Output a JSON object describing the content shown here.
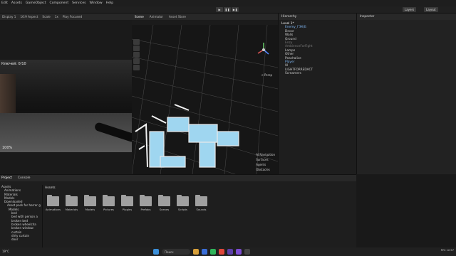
{
  "menu": [
    "Edit",
    "Assets",
    "GameObject",
    "Component",
    "Services",
    "Window",
    "Help"
  ],
  "toolbar": {
    "play": "▶",
    "pause": "❚❚",
    "step": "▶❚",
    "layers": "Layers",
    "layout": "Layout"
  },
  "game": {
    "tabs": [
      "Display 1",
      "16:9 Aspect",
      "Scale",
      "1x",
      "Play Focused"
    ],
    "hud_top": "Ключей: 0/10",
    "hud_bottom": "100%"
  },
  "scene": {
    "tabs": [
      "Scene",
      "Animator",
      "Asset Store"
    ],
    "gizmo": "< Persp",
    "overlay": [
      "AI Navigation",
      "Surfaces",
      "Agents",
      "Obstacles"
    ]
  },
  "hierarchy": {
    "title": "Hierarchy",
    "items": [
      {
        "label": "Level 1*",
        "indent": 0,
        "style": "normal"
      },
      {
        "label": "Enemy_ГЗК(Б",
        "indent": 1,
        "style": "blue"
      },
      {
        "label": "Decor",
        "indent": 1,
        "style": "normal"
      },
      {
        "label": "Walls",
        "indent": 1,
        "style": "normal"
      },
      {
        "label": "Ground",
        "indent": 1,
        "style": "normal"
      },
      {
        "label": "Enzy",
        "indent": 1,
        "style": "dim"
      },
      {
        "label": "AmbienceForFight",
        "indent": 1,
        "style": "dim"
      },
      {
        "label": "Lamps",
        "indent": 1,
        "style": "normal"
      },
      {
        "label": "Other",
        "indent": 1,
        "style": "normal"
      },
      {
        "label": "Peachalice",
        "indent": 1,
        "style": "normal"
      },
      {
        "label": "Player",
        "indent": 1,
        "style": "blue"
      },
      {
        "label": "UI",
        "indent": 1,
        "style": "normal"
      },
      {
        "label": "LIGHTFORREDACT",
        "indent": 1,
        "style": "normal"
      },
      {
        "label": "Screamers",
        "indent": 1,
        "style": "normal"
      }
    ]
  },
  "inspector": {
    "title": "Inspector"
  },
  "project": {
    "tabs": [
      "Project",
      "Console"
    ],
    "breadcrumb": "Assets",
    "tree": [
      "Assets",
      "Animations",
      "Materials",
      "Models",
      "Downloaded",
      "Asset pack for horror g",
      "Models",
      "bed",
      "bed with person a",
      "broken bed",
      "broken wheelcha",
      "broken window",
      "curtain",
      "dirty curtain",
      "door"
    ],
    "folders": [
      "Animations",
      "Materials",
      "Models",
      "Pictures",
      "Plugins",
      "Prefabs",
      "Scenes",
      "Scripts",
      "Sounds"
    ]
  },
  "taskbar": {
    "search": "Поиск",
    "weather": "19°C",
    "lang": "РУС",
    "time": "12:57"
  },
  "colors": {
    "accent": "#4aa3df",
    "panel": "#1e1e1e",
    "blueprint": "#9fd6f0"
  }
}
